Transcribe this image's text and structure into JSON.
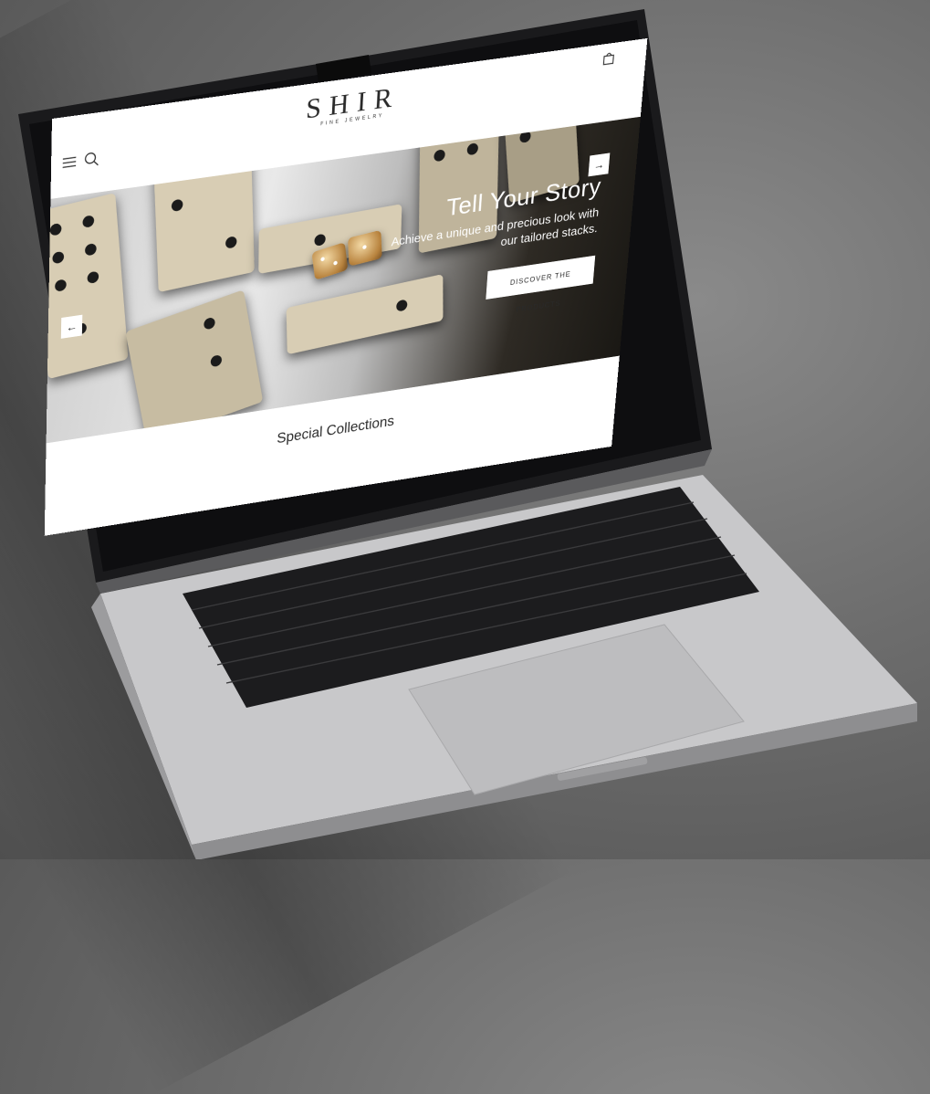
{
  "site": {
    "logo_text": "SHIR",
    "logo_subtitle": "FINE JEWELRY"
  },
  "header": {
    "menu_icon": "menu-icon",
    "search_icon": "search-icon",
    "bag_icon": "shopping-bag-icon"
  },
  "hero": {
    "title": "Tell Your Story",
    "subtitle_line1": "Achieve a unique and precious look with",
    "subtitle_line2": "our tailored stacks.",
    "cta_label": "DISCOVER THE PRODUCTS",
    "prev_arrow": "←",
    "next_arrow": "→"
  },
  "section": {
    "title": "Special Collections"
  },
  "colors": {
    "background": "#6d6d6d",
    "laptop_silver": "#c9c9cb",
    "keyboard": "#1c1c1e",
    "gold": "#c9975a"
  }
}
